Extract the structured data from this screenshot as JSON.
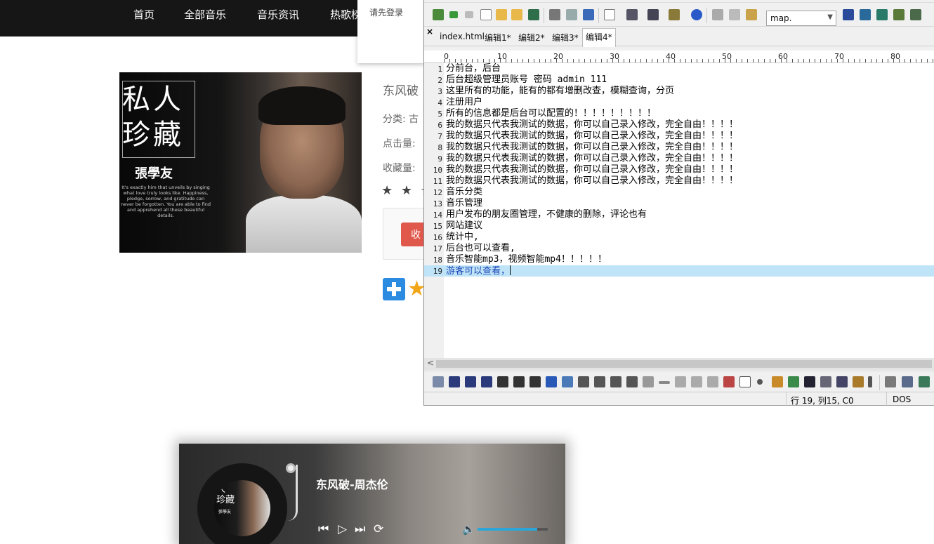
{
  "site": {
    "nav": [
      "首页",
      "全部音乐",
      "音乐资讯",
      "热歌榜"
    ],
    "login_popup": "请先登录",
    "cover": {
      "title_line1": "私人",
      "title_line2": "珍藏",
      "artist": "張學友",
      "blurb": "It's exactly him that unveils by singing what love truly looks like. Happiness, pledge, sorrow, and gratitude can never be forgotten. You are able to find and apprehend all these beautiful details."
    },
    "song_title_partial": "东风破",
    "meta": {
      "category": "分类: 古",
      "clicks": "点击量:",
      "favorites": "收藏量:"
    },
    "stars": "★ ★ ☆",
    "fav_button": "收",
    "share_star": "★"
  },
  "player": {
    "song": "东风破-周杰伦",
    "disc_title": "人\n珍藏",
    "disc_artist": "張學友",
    "controls": [
      "⏮",
      "▷",
      "⏭",
      "⟳"
    ],
    "volume_icon": "🔈",
    "volume": 0.85
  },
  "editor": {
    "toolbar_select": "map.",
    "tabs": [
      "index.html",
      "编辑1*",
      "编辑2*",
      "编辑3*",
      "编辑4*"
    ],
    "ruler_labels": [
      "0",
      "10",
      "20",
      "30",
      "40",
      "50",
      "60",
      "70",
      "80"
    ],
    "lines": [
      "分前台，后台",
      "后台超级管理员账号 密码 admin 111",
      "这里所有的功能，能有的都有增删改查，模糊查询，分页",
      "注册用户",
      "所有的信息都是后台可以配置的！！！！！！！！！",
      "我的数据只代表我测试的数据，你可以自己录入修改，完全自由！！！！",
      "我的数据只代表我测试的数据，你可以自己录入修改，完全自由！！！！",
      "我的数据只代表我测试的数据，你可以自己录入修改，完全自由！！！！",
      "我的数据只代表我测试的数据，你可以自己录入修改，完全自由！！！！",
      "我的数据只代表我测试的数据，你可以自己录入修改，完全自由！！！！",
      "我的数据只代表我测试的数据，你可以自己录入修改，完全自由！！！！",
      "音乐分类",
      "音乐管理",
      "用户发布的朋友圈管理，不健康的删除，评论也有",
      "网站建议",
      "统计中,",
      "后台也可以查看,",
      "音乐智能mp3，视频智能mp4！！！！！",
      "游客可以查看，"
    ],
    "current_line": 19,
    "status_position": "行 19, 列15, C0",
    "status_format": "DOS",
    "tab_close": "×",
    "scroll_arrow": "<"
  }
}
